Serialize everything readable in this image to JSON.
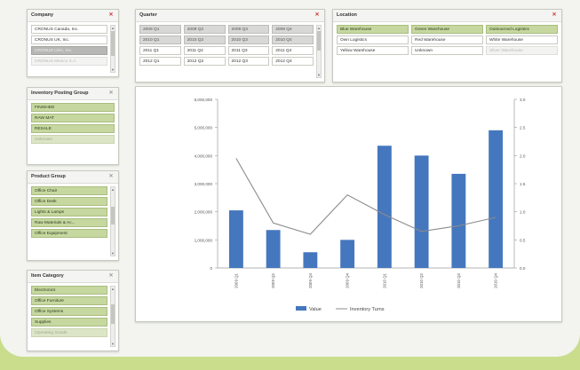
{
  "company": {
    "title": "Company",
    "items": [
      "CRONUS Canada, Inc.",
      "CRONUS UK, Inc.",
      "CRONUS USA, Inc.",
      "CRONUS Mexico S.A."
    ]
  },
  "quarter": {
    "title": "Quarter",
    "items": [
      "2009 Q1",
      "2009 Q2",
      "2009 Q3",
      "2009 Q4",
      "2010 Q1",
      "2010 Q2",
      "2010 Q3",
      "2010 Q4",
      "2011 Q1",
      "2011 Q2",
      "2011 Q3",
      "2011 Q4",
      "2012 Q1",
      "2012 Q2",
      "2012 Q3",
      "2012 Q4"
    ]
  },
  "location": {
    "title": "Location",
    "items": [
      "Blue Warehouse",
      "Green Warehouse",
      "Outsourced Logistics",
      "Own Logistics",
      "Red Warehouse",
      "White Warehouse",
      "Yellow Warehouse",
      "Unknown",
      "Silver Warehouse"
    ]
  },
  "inventory_posting_group": {
    "title": "Inventory Posting Group",
    "items": [
      "FINISHED",
      "RAW MAT",
      "RESALE",
      "Unknown"
    ]
  },
  "product_group": {
    "title": "Product Group",
    "items": [
      "Office Chair",
      "Office Desk",
      "Lights & Lamps",
      "Raw Materials & Ac...",
      "Office Equipment"
    ]
  },
  "item_category": {
    "title": "Item Category",
    "items": [
      "Electronics",
      "Office Furniture",
      "Office Systems",
      "Supplies",
      "Operating Goods"
    ]
  },
  "colors": {
    "bar": "#4577be",
    "line": "#8b8b8b",
    "selected_green": "#c6d8a0",
    "clear_red": "#cc3333"
  },
  "chart_data": {
    "type": "bar",
    "categories": [
      "2009 Q1",
      "2009 Q2",
      "2009 Q3",
      "2009 Q4",
      "2010 Q1",
      "2010 Q2",
      "2010 Q3",
      "2010 Q4"
    ],
    "series": [
      {
        "name": "Value",
        "type": "bar",
        "axis": "left",
        "values": [
          2050000,
          1350000,
          560000,
          1000000,
          4350000,
          4000000,
          3350000,
          4900000
        ]
      },
      {
        "name": "Inventory Turns",
        "type": "line",
        "axis": "right",
        "values": [
          1.95,
          0.8,
          0.6,
          1.3,
          0.95,
          0.65,
          0.75,
          0.9
        ]
      }
    ],
    "y_left_ticks": [
      "0",
      "1,000,000",
      "2,000,000",
      "3,000,000",
      "4,000,000",
      "5,000,000",
      "6,000,000"
    ],
    "y_right_ticks": [
      "0.0",
      "0.5",
      "1.0",
      "1.5",
      "2.0",
      "2.5",
      "3.0"
    ],
    "ylim_left": [
      0,
      6000000
    ],
    "ylim_right": [
      0,
      3.0
    ],
    "legend": [
      "Value",
      "Inventory Turns"
    ],
    "legend_position": "bottom",
    "grid": false
  }
}
